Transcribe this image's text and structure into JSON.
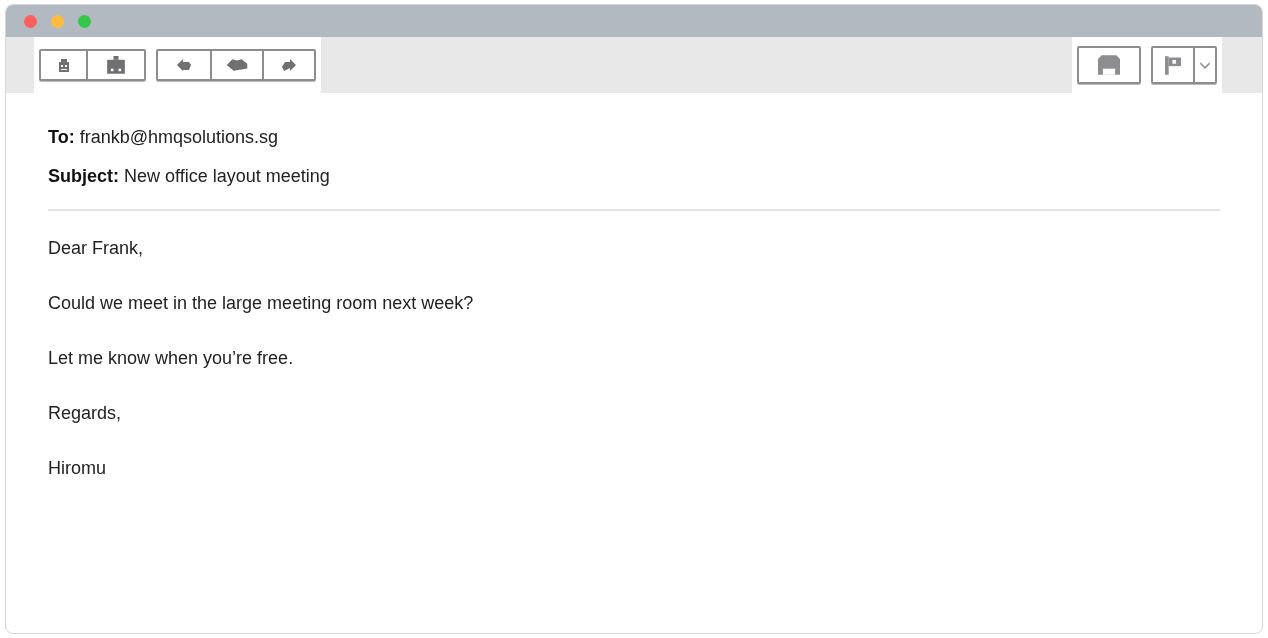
{
  "toolbar": {
    "left_groups": [
      [
        {
          "kind": "get"
        },
        {
          "kind": "inbox"
        }
      ],
      [
        {
          "kind": "reply"
        },
        {
          "kind": "reply_all"
        },
        {
          "kind": "forward"
        }
      ]
    ],
    "right_groups": [
      [
        {
          "kind": "print"
        }
      ],
      [
        {
          "kind": "flag"
        },
        {
          "kind": "menu"
        }
      ]
    ]
  },
  "header": {
    "to_label": "To:",
    "to": "frankb@hmqsolutions.sg",
    "subject_label": "Subject:",
    "subject": "New office layout meeting"
  },
  "body": [
    "Dear Frank,",
    "Could we meet in the large meeting room next week?",
    "Let me know when you’re free.",
    "Regards,",
    "Hiromu"
  ]
}
